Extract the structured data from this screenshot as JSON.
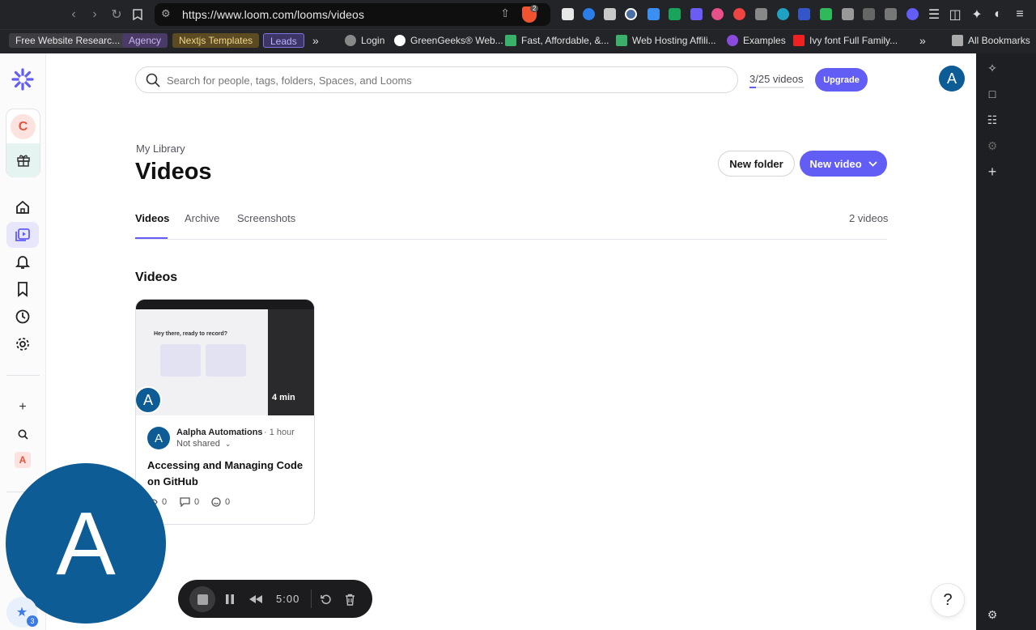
{
  "browser": {
    "url": "https://www.loom.com/looms/videos",
    "brave_badge": "2",
    "bookmarks_chips": [
      {
        "label": "Free Website Researc...",
        "bg": "#3d3d42",
        "fg": "#e8e8e8"
      },
      {
        "label": "Agency",
        "bg": "#4a3a66",
        "fg": "#c8b5f0"
      },
      {
        "label": "Nextjs Templates",
        "bg": "#5b4a22",
        "fg": "#f2d689"
      },
      {
        "label": "Leads",
        "bg": "#3c3566",
        "fg": "#b9b2ff"
      }
    ],
    "bookmarks": [
      "Login",
      "GreenGeeks® Web...",
      "Fast, Affordable, &...",
      "Web Hosting Affili...",
      "Examples",
      "Ivy font Full Family..."
    ],
    "all_bookmarks": "All Bookmarks"
  },
  "search": {
    "placeholder": "Search for people, tags, folders, Spaces, and Looms"
  },
  "quota": {
    "label": "3/25 videos",
    "used": 3,
    "total": 25
  },
  "upgrade_label": "Upgrade",
  "user_initial": "A",
  "workspace_initial": "C",
  "page": {
    "breadcrumb": "My Library",
    "title": "Videos",
    "new_folder": "New folder",
    "new_video": "New video"
  },
  "tabs": [
    {
      "label": "Videos",
      "active": true
    },
    {
      "label": "Archive",
      "active": false
    },
    {
      "label": "Screenshots",
      "active": false
    }
  ],
  "video_count": "2 videos",
  "section_title": "Videos",
  "video": {
    "thumbnail_heading": "Hey there, ready to record?",
    "duration": "4 min",
    "owner": "Aalpha Automations",
    "time": "· 1 hour",
    "sharing": "Not shared",
    "title": "Accessing and Managing Code on GitHub",
    "views": "0",
    "comments": "0",
    "reactions": "0"
  },
  "recorder": {
    "timer": "5:00",
    "bubble_initial": "A"
  },
  "notification_count": "3",
  "help_label": "?",
  "colors": {
    "accent": "#625df5",
    "avatar": "#0d5c96"
  }
}
